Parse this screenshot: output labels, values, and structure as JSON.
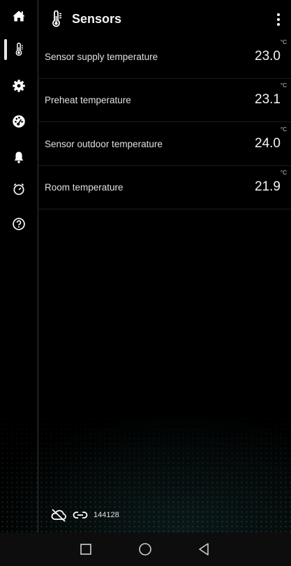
{
  "header": {
    "title": "Sensors",
    "icon": "thermometer-icon"
  },
  "sidebar": {
    "items": [
      {
        "name": "home",
        "icon": "home-icon",
        "active": false
      },
      {
        "name": "sensors",
        "icon": "thermometer-icon",
        "active": true
      },
      {
        "name": "settings",
        "icon": "gear-icon",
        "active": false
      },
      {
        "name": "dashboard",
        "icon": "gauge-icon",
        "active": false
      },
      {
        "name": "alarms",
        "icon": "bell-icon",
        "active": false
      },
      {
        "name": "timer",
        "icon": "timer-icon",
        "active": false
      },
      {
        "name": "help",
        "icon": "help-icon",
        "active": false
      }
    ]
  },
  "sensors": [
    {
      "label": "Sensor supply temperature",
      "value": "23.0",
      "unit": "°C"
    },
    {
      "label": "Preheat temperature",
      "value": "23.1",
      "unit": "°C"
    },
    {
      "label": "Sensor outdoor temperature",
      "value": "24.0",
      "unit": "°C"
    },
    {
      "label": "Room temperature",
      "value": "21.9",
      "unit": "°C"
    }
  ],
  "status": {
    "cloud_icon": "cloud-off-icon",
    "link_icon": "link-icon",
    "device_id": "144128"
  },
  "navbar": {
    "items": [
      "recents-button",
      "home-button",
      "back-button"
    ]
  },
  "colors": {
    "background": "#000000",
    "text": "#ffffff",
    "divider": "#3a3a3a"
  }
}
